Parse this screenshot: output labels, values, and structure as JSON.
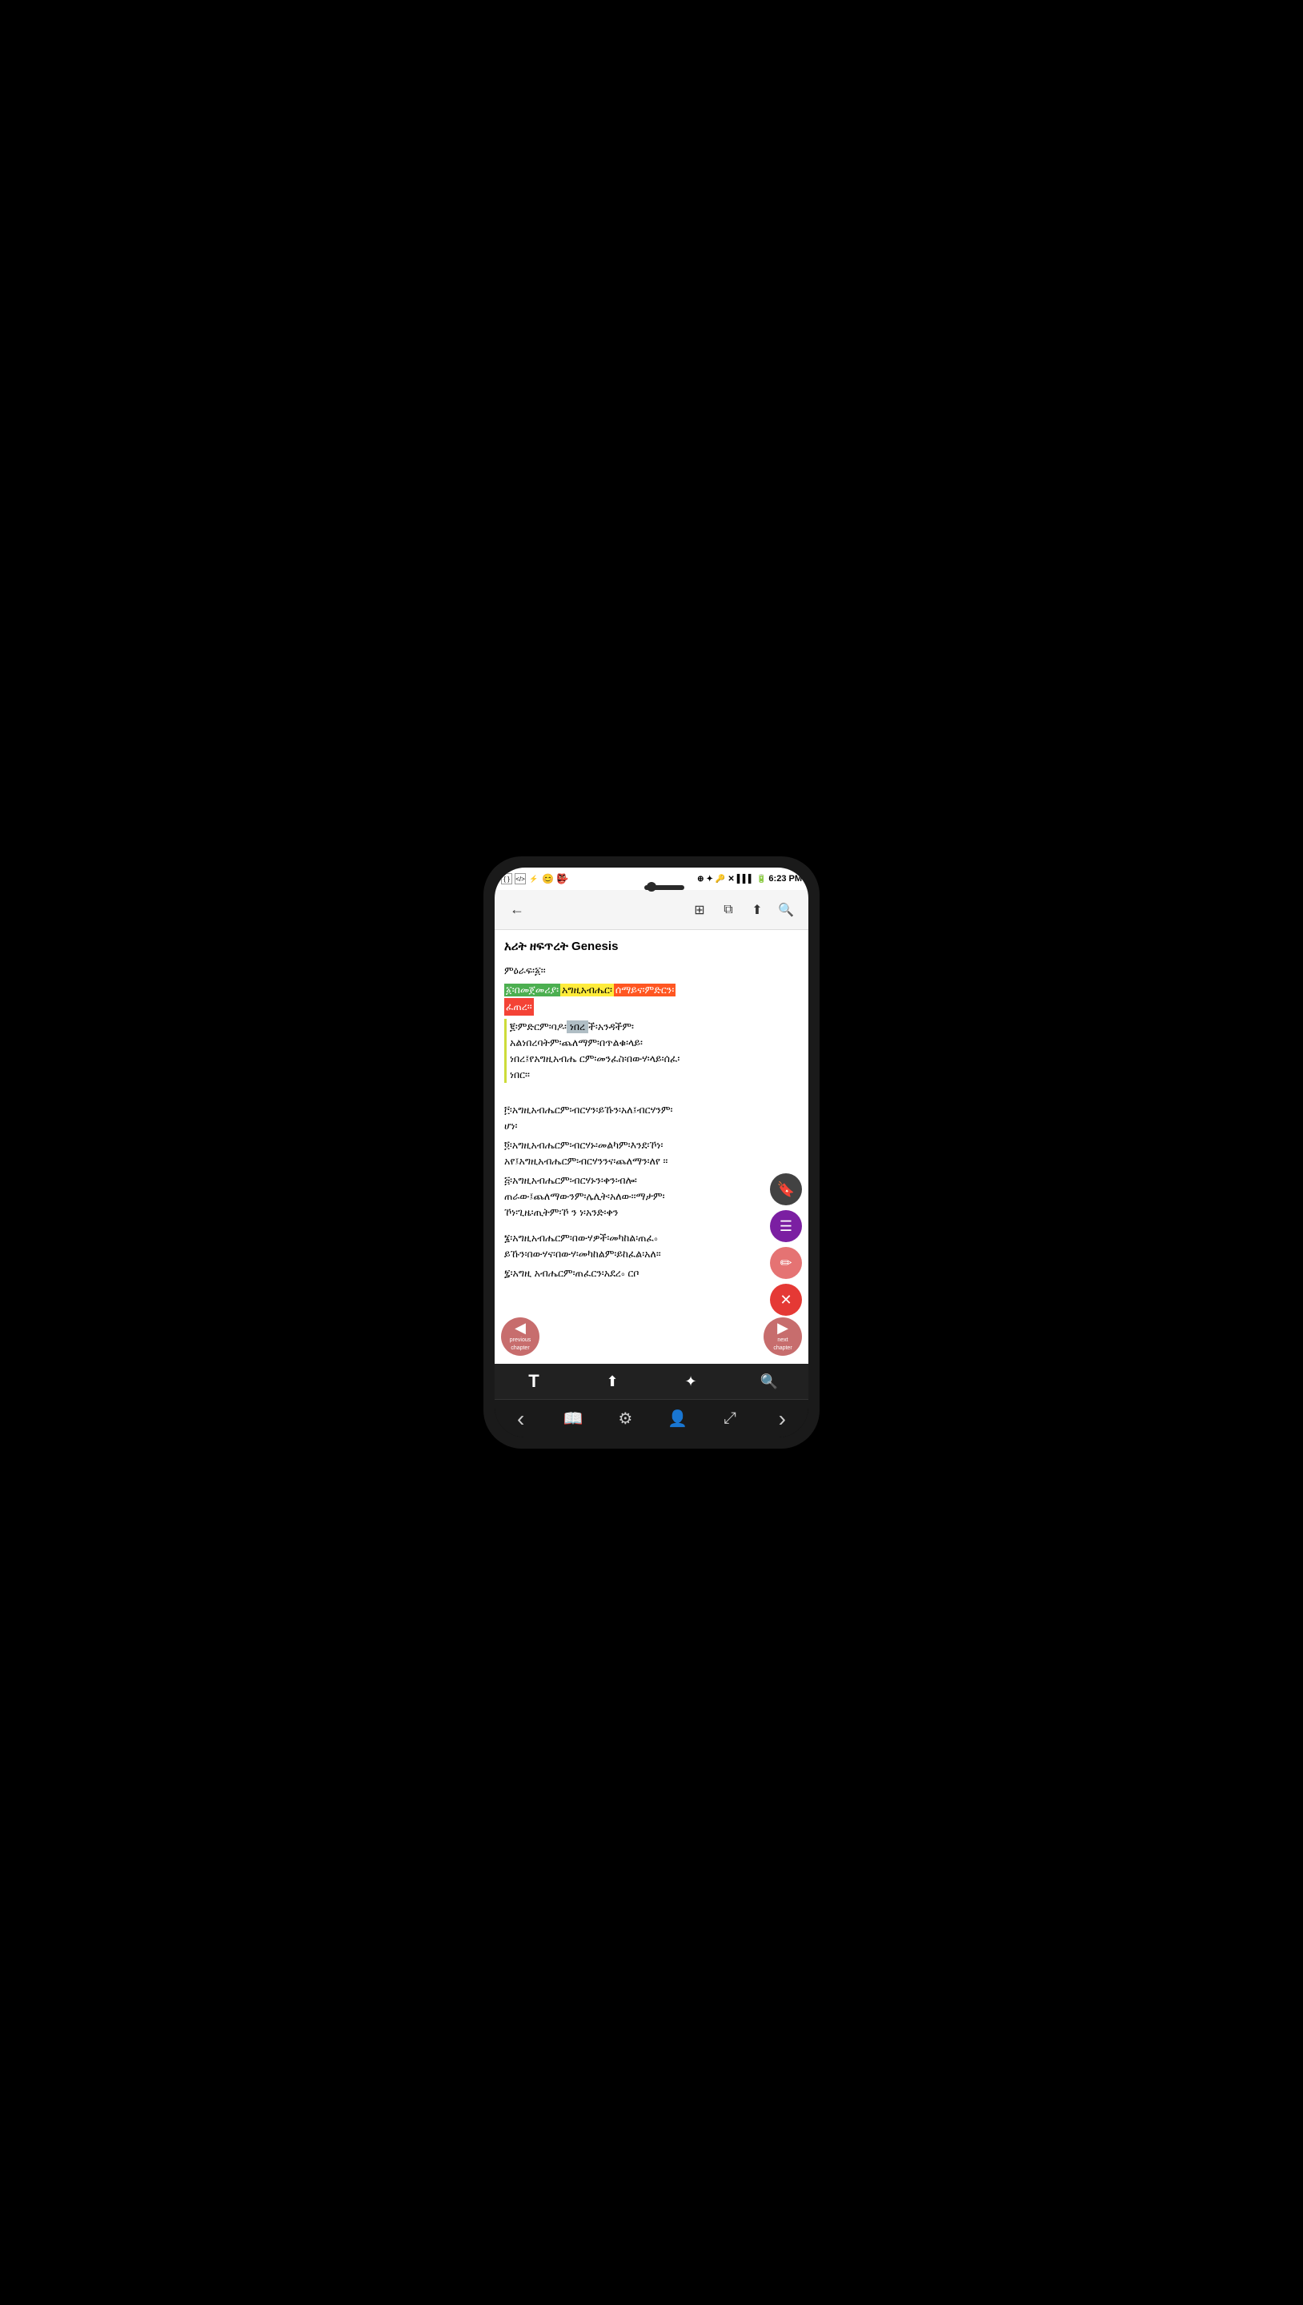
{
  "phone": {
    "status_bar": {
      "time": "6:23 PM",
      "icons_left": [
        "code1",
        "code2",
        "usb",
        "emoji-smile",
        "devil"
      ],
      "icons_right": [
        "location",
        "bluetooth",
        "key",
        "signal-x",
        "signal",
        "battery"
      ]
    },
    "toolbar": {
      "back_label": "←",
      "grid_label": "⊞",
      "copy_label": "⧉",
      "share_label": "⬆",
      "search_label": "🔍"
    },
    "content": {
      "title": "አሪት ዘፍጥረት Genesis",
      "prefix": "ምዕራፍ፡፩፡፡",
      "verses": [
        {
          "num": "1",
          "text": "፩፡በመጀመሪያ፡አግዚአብሔር፡ሰማይና፡ምድርን፡ፈጠረ፡፡"
        },
        {
          "num": "2",
          "text": "፪፡ምድርም፡ባዶ፡ነበረች፡አንዳችም፡አልነበረባትም፡ጨለማም፡በጥልቁ፡ላይ፡ነበረ፤የአግዚአብሔ ርም፡መንፈስ፡በውሃ፡ላይ፡ሰፈ፡ነበር፡፡"
        },
        {
          "num": "3",
          "text": "፫፡አግዚአብሔርም፡ብርሃን፡ይኹን፡አለ፤ብርሃንም፡ሆነ፡"
        },
        {
          "num": "4",
          "text": "፬፡አግዚአብሔርም፡ብርሃኑ፡መልካም፡እንደ፡ኾነ፡አየ፤አግዚአብሔርም፡ብርሃንንና፡ጨለማን፡ለየ ፡፡"
        },
        {
          "num": "5",
          "text": "፭፡አግዚአብሔርም፡ብርሃኑን፡ቀን፡ብሎ፡ጠራው፤ጨለማውንም፡ሌሊት፡አለው፡፡ማታም፡ኾነ፡ጊዜ፡ጢትም፡ኾ ን ነ፡አንድ፡ቀን"
        },
        {
          "num": "6",
          "text": "፮፡አግዚአብሔርም፡በውሃዎች፡መካከል፡ጠፈ⸰ ይኹን፡በውሃና፡በውሃ፡መካከልም፡ይከፈል፡አለ፡፡"
        },
        {
          "num": "7",
          "text": "፯፡አግዚ አብሔርም፡ጠፈርን፡አደረ⸰ ርቦ"
        }
      ]
    },
    "nav": {
      "previous_label": "previous\nchapter",
      "next_label": "next\nchapter"
    },
    "fab": {
      "bookmark": "🔖",
      "list": "☰",
      "edit": "✏",
      "close": "✕"
    },
    "bottom_toolbar": {
      "text_btn": "T",
      "share_btn": "⬆",
      "highlight_btn": "✦",
      "search_btn": "🔍"
    },
    "nav_bar": {
      "back": "‹",
      "book": "📖",
      "settings": "⚙",
      "user": "👤",
      "expand": "⤢",
      "forward": "›"
    }
  }
}
